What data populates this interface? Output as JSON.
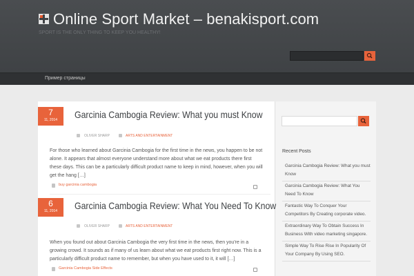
{
  "site": {
    "title": "Online Sport Market – benakisport.com",
    "tagline": "SPORT IS THE ONLY THING TO KEEP YOU HEALTHY!"
  },
  "nav": {
    "items": [
      {
        "label": "Пример страницы"
      }
    ]
  },
  "posts": [
    {
      "day": "7",
      "month": "11, 2014",
      "title": "Garcinia Cambogia Review: What you must Know",
      "author": "OLIVER SHARP",
      "category": "ARTS AND ENTERTAINMENT",
      "excerpt": "For those who learned about Garcinia Cambogia for the first time in the news, you happen to be not alone. It appears that almost everyone understand more about what we eat products there first these days. This can be a particularly difficult product name to keep in mind, however, when you will get the hang […]",
      "tag": "buy garcinia cambogia"
    },
    {
      "day": "6",
      "month": "11, 2014",
      "title": "Garcinia Cambogia Review: What You Need To Know",
      "author": "OLIVER SHARP",
      "category": "ARTS AND ENTERTAINMENT",
      "excerpt": "When you found out about Garcinia Cambogia the very first time in the news, then you're in a growing crowd. It sounds as if many of us learn about what we eat products first right now. This is a particularly difficult product name to remember, but when you have used to it, it will […]",
      "tag": "Garcinia Cambogia Side Effects"
    }
  ],
  "sidebar": {
    "recent_title": "Recent Posts",
    "recent_posts": [
      "Garcinia Cambogia Review: What you must Know",
      "Garcinia Cambogia Review: What You Need To Know",
      "Fantastic Way To Conquer Your Competitors By Creating corporate video.",
      "Extraordinary Way To Obtain Success In Business With video marketing singapore.",
      "Simple Way To Rise Rise In Popularity Of Your Company By Using SEO."
    ]
  },
  "icons": {
    "search": "search-icon",
    "user": "user-icon",
    "folder": "folder-icon",
    "tag": "tag-icon",
    "share": "share-icon"
  },
  "colors": {
    "accent": "#e8633b",
    "header_bg": "#45484b",
    "nav_bg": "#2f3133"
  }
}
